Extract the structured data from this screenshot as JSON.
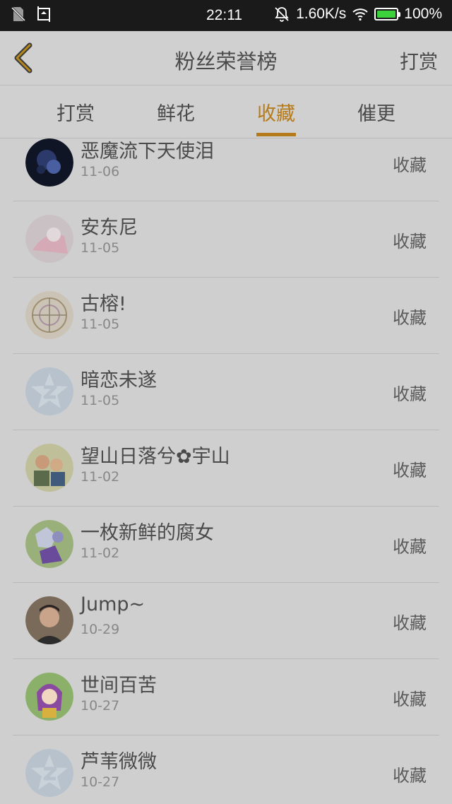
{
  "status_bar": {
    "time": "22:11",
    "network_speed": "1.60K/s",
    "battery_percent": "100%",
    "battery_level": 1.0,
    "icons": [
      "sim-off-icon",
      "screenshot-icon",
      "bell-muted-icon",
      "wifi-icon",
      "battery-icon"
    ]
  },
  "header": {
    "back_icon": "chevron-left-icon",
    "title": "粉丝荣誉榜",
    "action_label": "打赏"
  },
  "tabs": [
    {
      "label": "打赏",
      "active": false
    },
    {
      "label": "鲜花",
      "active": false
    },
    {
      "label": "收藏",
      "active": true
    },
    {
      "label": "催更",
      "active": false
    }
  ],
  "colors": {
    "accent": "#b57a1a",
    "background": "#cfcfcf",
    "text": "#4a4a4a",
    "subtext": "#888888"
  },
  "list": [
    {
      "name": "恶魔流下天使泪",
      "date": "11-06",
      "action": "收藏",
      "avatar": "dark-blue-portrait"
    },
    {
      "name": "安东尼",
      "date": "11-05",
      "action": "收藏",
      "avatar": "pink-drawing"
    },
    {
      "name": "古榕!",
      "date": "11-05",
      "action": "收藏",
      "avatar": "sketch-circle"
    },
    {
      "name": "暗恋未遂",
      "date": "11-05",
      "action": "收藏",
      "avatar": "default-star-avatar"
    },
    {
      "name": "望山日落兮✿宇山",
      "date": "11-02",
      "action": "收藏",
      "avatar": "cartoon-characters"
    },
    {
      "name": "一枚新鲜的腐女",
      "date": "11-02",
      "action": "收藏",
      "avatar": "anime-girl-purple"
    },
    {
      "name": "Jump~",
      "date": "10-29",
      "action": "收藏",
      "avatar": "man-photo"
    },
    {
      "name": "世间百苦",
      "date": "10-27",
      "action": "收藏",
      "avatar": "anime-girl-green"
    },
    {
      "name": "芦苇微微",
      "date": "10-27",
      "action": "收藏",
      "avatar": "default-star-avatar"
    }
  ]
}
